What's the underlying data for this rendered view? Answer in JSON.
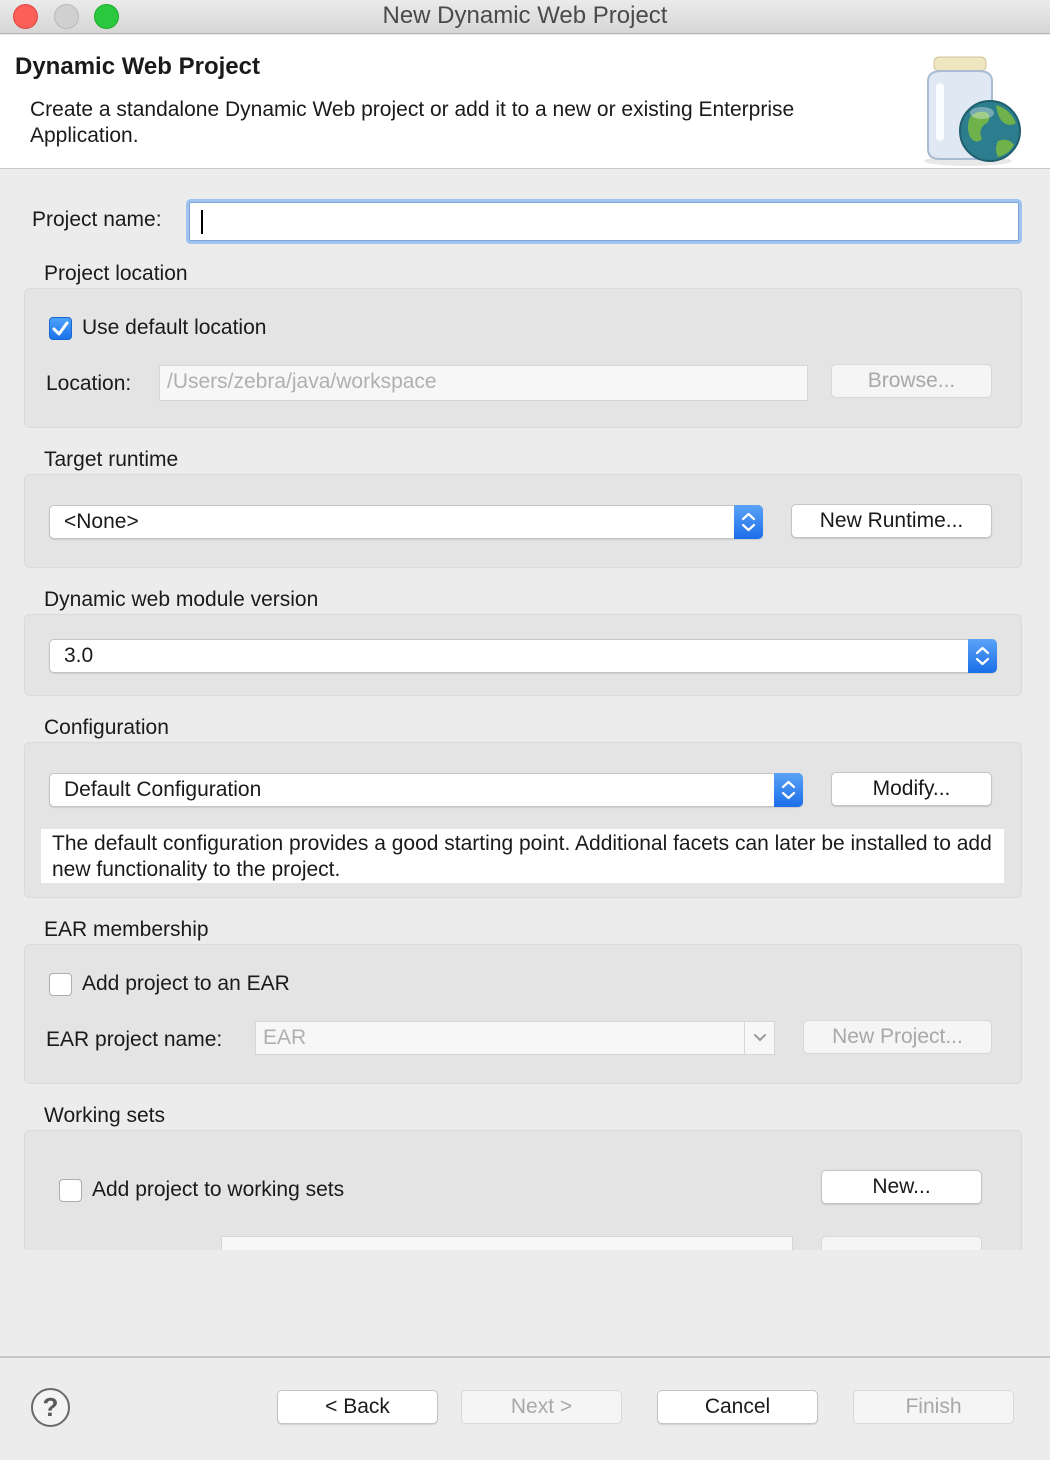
{
  "window": {
    "title": "New Dynamic Web Project"
  },
  "banner": {
    "title": "Dynamic Web Project",
    "description": "Create a standalone Dynamic Web project or add it to a new or existing Enterprise Application."
  },
  "project_name": {
    "label": "Project name:",
    "value": ""
  },
  "project_location": {
    "heading": "Project location",
    "use_default_label": "Use default location",
    "use_default_checked": true,
    "location_label": "Location:",
    "location_value": "/Users/zebra/java/workspace",
    "browse_label": "Browse..."
  },
  "target_runtime": {
    "heading": "Target runtime",
    "selected": "<None>",
    "new_runtime_label": "New Runtime..."
  },
  "module_version": {
    "heading": "Dynamic web module version",
    "selected": "3.0"
  },
  "configuration": {
    "heading": "Configuration",
    "selected": "Default Configuration",
    "modify_label": "Modify...",
    "description": "The default configuration provides a good starting point. Additional facets can later be installed to add new functionality to the project."
  },
  "ear_membership": {
    "heading": "EAR membership",
    "add_label": "Add project to an EAR",
    "add_checked": false,
    "name_label": "EAR project name:",
    "name_value": "EAR",
    "new_project_label": "New Project..."
  },
  "working_sets": {
    "heading": "Working sets",
    "add_label": "Add project to working sets",
    "add_checked": false,
    "new_label": "New..."
  },
  "footer": {
    "help_glyph": "?",
    "back_label": "< Back",
    "next_label": "Next >",
    "cancel_label": "Cancel",
    "finish_label": "Finish"
  },
  "colors": {
    "accent": "#1b72ea",
    "focus_ring": "#9fc2ef",
    "close": "#fc5f57",
    "maximize": "#2ac83f"
  }
}
